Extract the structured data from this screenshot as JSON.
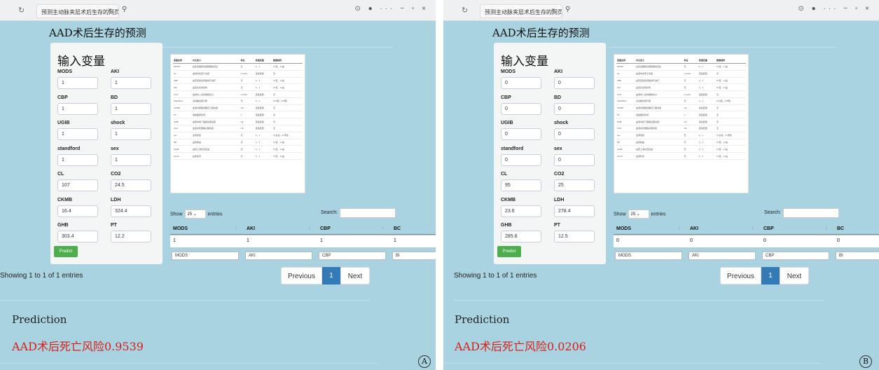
{
  "browser": {
    "tab_title": "预测主动脉夹层术后生存的网页计算器",
    "search_glyph": "⚲",
    "controls": "⊙ ● ··· − ▫ ×"
  },
  "panels": {
    "A": {
      "label": "A",
      "title": "AAD术后生存的预测",
      "input_heading": "输入变量",
      "fields": [
        {
          "label": "MODS",
          "value": "1"
        },
        {
          "label": "AKI",
          "value": "1"
        },
        {
          "label": "CBP",
          "value": "1"
        },
        {
          "label": "BD",
          "value": "1"
        },
        {
          "label": "UGIB",
          "value": "1"
        },
        {
          "label": "shock",
          "value": "1"
        },
        {
          "label": "standford",
          "value": "1"
        },
        {
          "label": "sex",
          "value": "1"
        },
        {
          "label": "CL",
          "value": "107"
        },
        {
          "label": "CO2",
          "value": "24.5"
        },
        {
          "label": "CKMB",
          "value": "16.4"
        },
        {
          "label": "LDH",
          "value": "324.4"
        },
        {
          "label": "GHB",
          "value": "303.4"
        },
        {
          "label": "PT",
          "value": "12.2"
        }
      ],
      "predict_label": "Predict",
      "show_label": "Show",
      "entries_value": "25",
      "entries_label": "entries",
      "search_label": "Search:",
      "columns": [
        "MODS",
        "AKI",
        "CBP",
        "BC"
      ],
      "row": [
        "1",
        "1",
        "1",
        "1"
      ],
      "filters": [
        "MODS",
        "AKI",
        "CBP",
        "BI"
      ],
      "info": "Showing 1 to 1 of 1 entries",
      "pager": {
        "prev": "Previous",
        "current": "1",
        "next": "Next"
      },
      "prediction_heading": "Prediction",
      "result": "AAD术后死亡风险0.9539"
    },
    "B": {
      "label": "B",
      "title": "AAD术后生存的预测",
      "input_heading": "输入变量",
      "fields": [
        {
          "label": "MODS",
          "value": "0"
        },
        {
          "label": "AKI",
          "value": "0"
        },
        {
          "label": "CBP",
          "value": "0"
        },
        {
          "label": "BD",
          "value": "0"
        },
        {
          "label": "UGIB",
          "value": "0"
        },
        {
          "label": "shock",
          "value": "0"
        },
        {
          "label": "standford",
          "value": "0"
        },
        {
          "label": "sex",
          "value": "0"
        },
        {
          "label": "CL",
          "value": "95"
        },
        {
          "label": "CO2",
          "value": "25"
        },
        {
          "label": "CKMB",
          "value": "23.6"
        },
        {
          "label": "LDH",
          "value": "278.4"
        },
        {
          "label": "GHB",
          "value": "285.8"
        },
        {
          "label": "PT",
          "value": "12.5"
        }
      ],
      "predict_label": "Predict",
      "show_label": "Show",
      "entries_value": "25",
      "entries_label": "entries",
      "search_label": "Search:",
      "columns": [
        "MODS",
        "AKI",
        "CBP",
        "BC"
      ],
      "row": [
        "0",
        "0",
        "0",
        "0"
      ],
      "filters": [
        "MODS",
        "AKI",
        "CBP",
        "BI"
      ],
      "info": "Showing 1 to 1 of 1 entries",
      "pager": {
        "prev": "Previous",
        "current": "1",
        "next": "Next"
      },
      "prediction_heading": "Prediction",
      "result": "AAD术后死亡风险0.0206"
    }
  },
  "variable_table": {
    "headers": [
      "变量名称",
      "中文含义",
      "单位",
      "取值范围",
      "赋值规则"
    ],
    "rows": [
      [
        "MODS",
        "是否多器官功能障碍综合征",
        "无",
        "0，1",
        "0=否，1=是"
      ],
      [
        "CL",
        "血液中氯离子浓度",
        "mmol/L",
        "连续变量",
        "无"
      ],
      [
        "CBP",
        "是否连续性肾脏替代治疗",
        "无",
        "0，1",
        "0=否，1=是"
      ],
      [
        "AKI",
        "是否急性肾损伤",
        "无",
        "0，1",
        "0=否，1=是"
      ],
      [
        "CO2",
        "血液中二氧化碳结合力",
        "mmol/L",
        "连续变量",
        "无"
      ],
      [
        "Standford",
        "主动脉夹层分型",
        "无",
        "0，1",
        "0=A型，1=B型"
      ],
      [
        "CKMB",
        "血液中肌酸激酶同工酶浓度",
        "U/L",
        "连续变量",
        "无"
      ],
      [
        "PT",
        "凝血酶原时间",
        "s",
        "连续变量",
        "无"
      ],
      [
        "GHB",
        "血液中羟丁酸脱氢酶浓度",
        "U/L",
        "连续变量",
        "无"
      ],
      [
        "LDH",
        "血液中乳酸脱氢酶浓度",
        "U/L",
        "连续变量",
        "无"
      ],
      [
        "sex",
        "患者性别",
        "无",
        "0，1",
        "0=女性，1=男性"
      ],
      [
        "BD",
        "是否输血",
        "无",
        "0，1",
        "0=否，1=是"
      ],
      [
        "UGIB",
        "是否上消化道出血",
        "无",
        "0，1",
        "0=否，1=是"
      ],
      [
        "shock",
        "是否休克",
        "无",
        "0，1",
        "0=否，1=是"
      ]
    ]
  }
}
